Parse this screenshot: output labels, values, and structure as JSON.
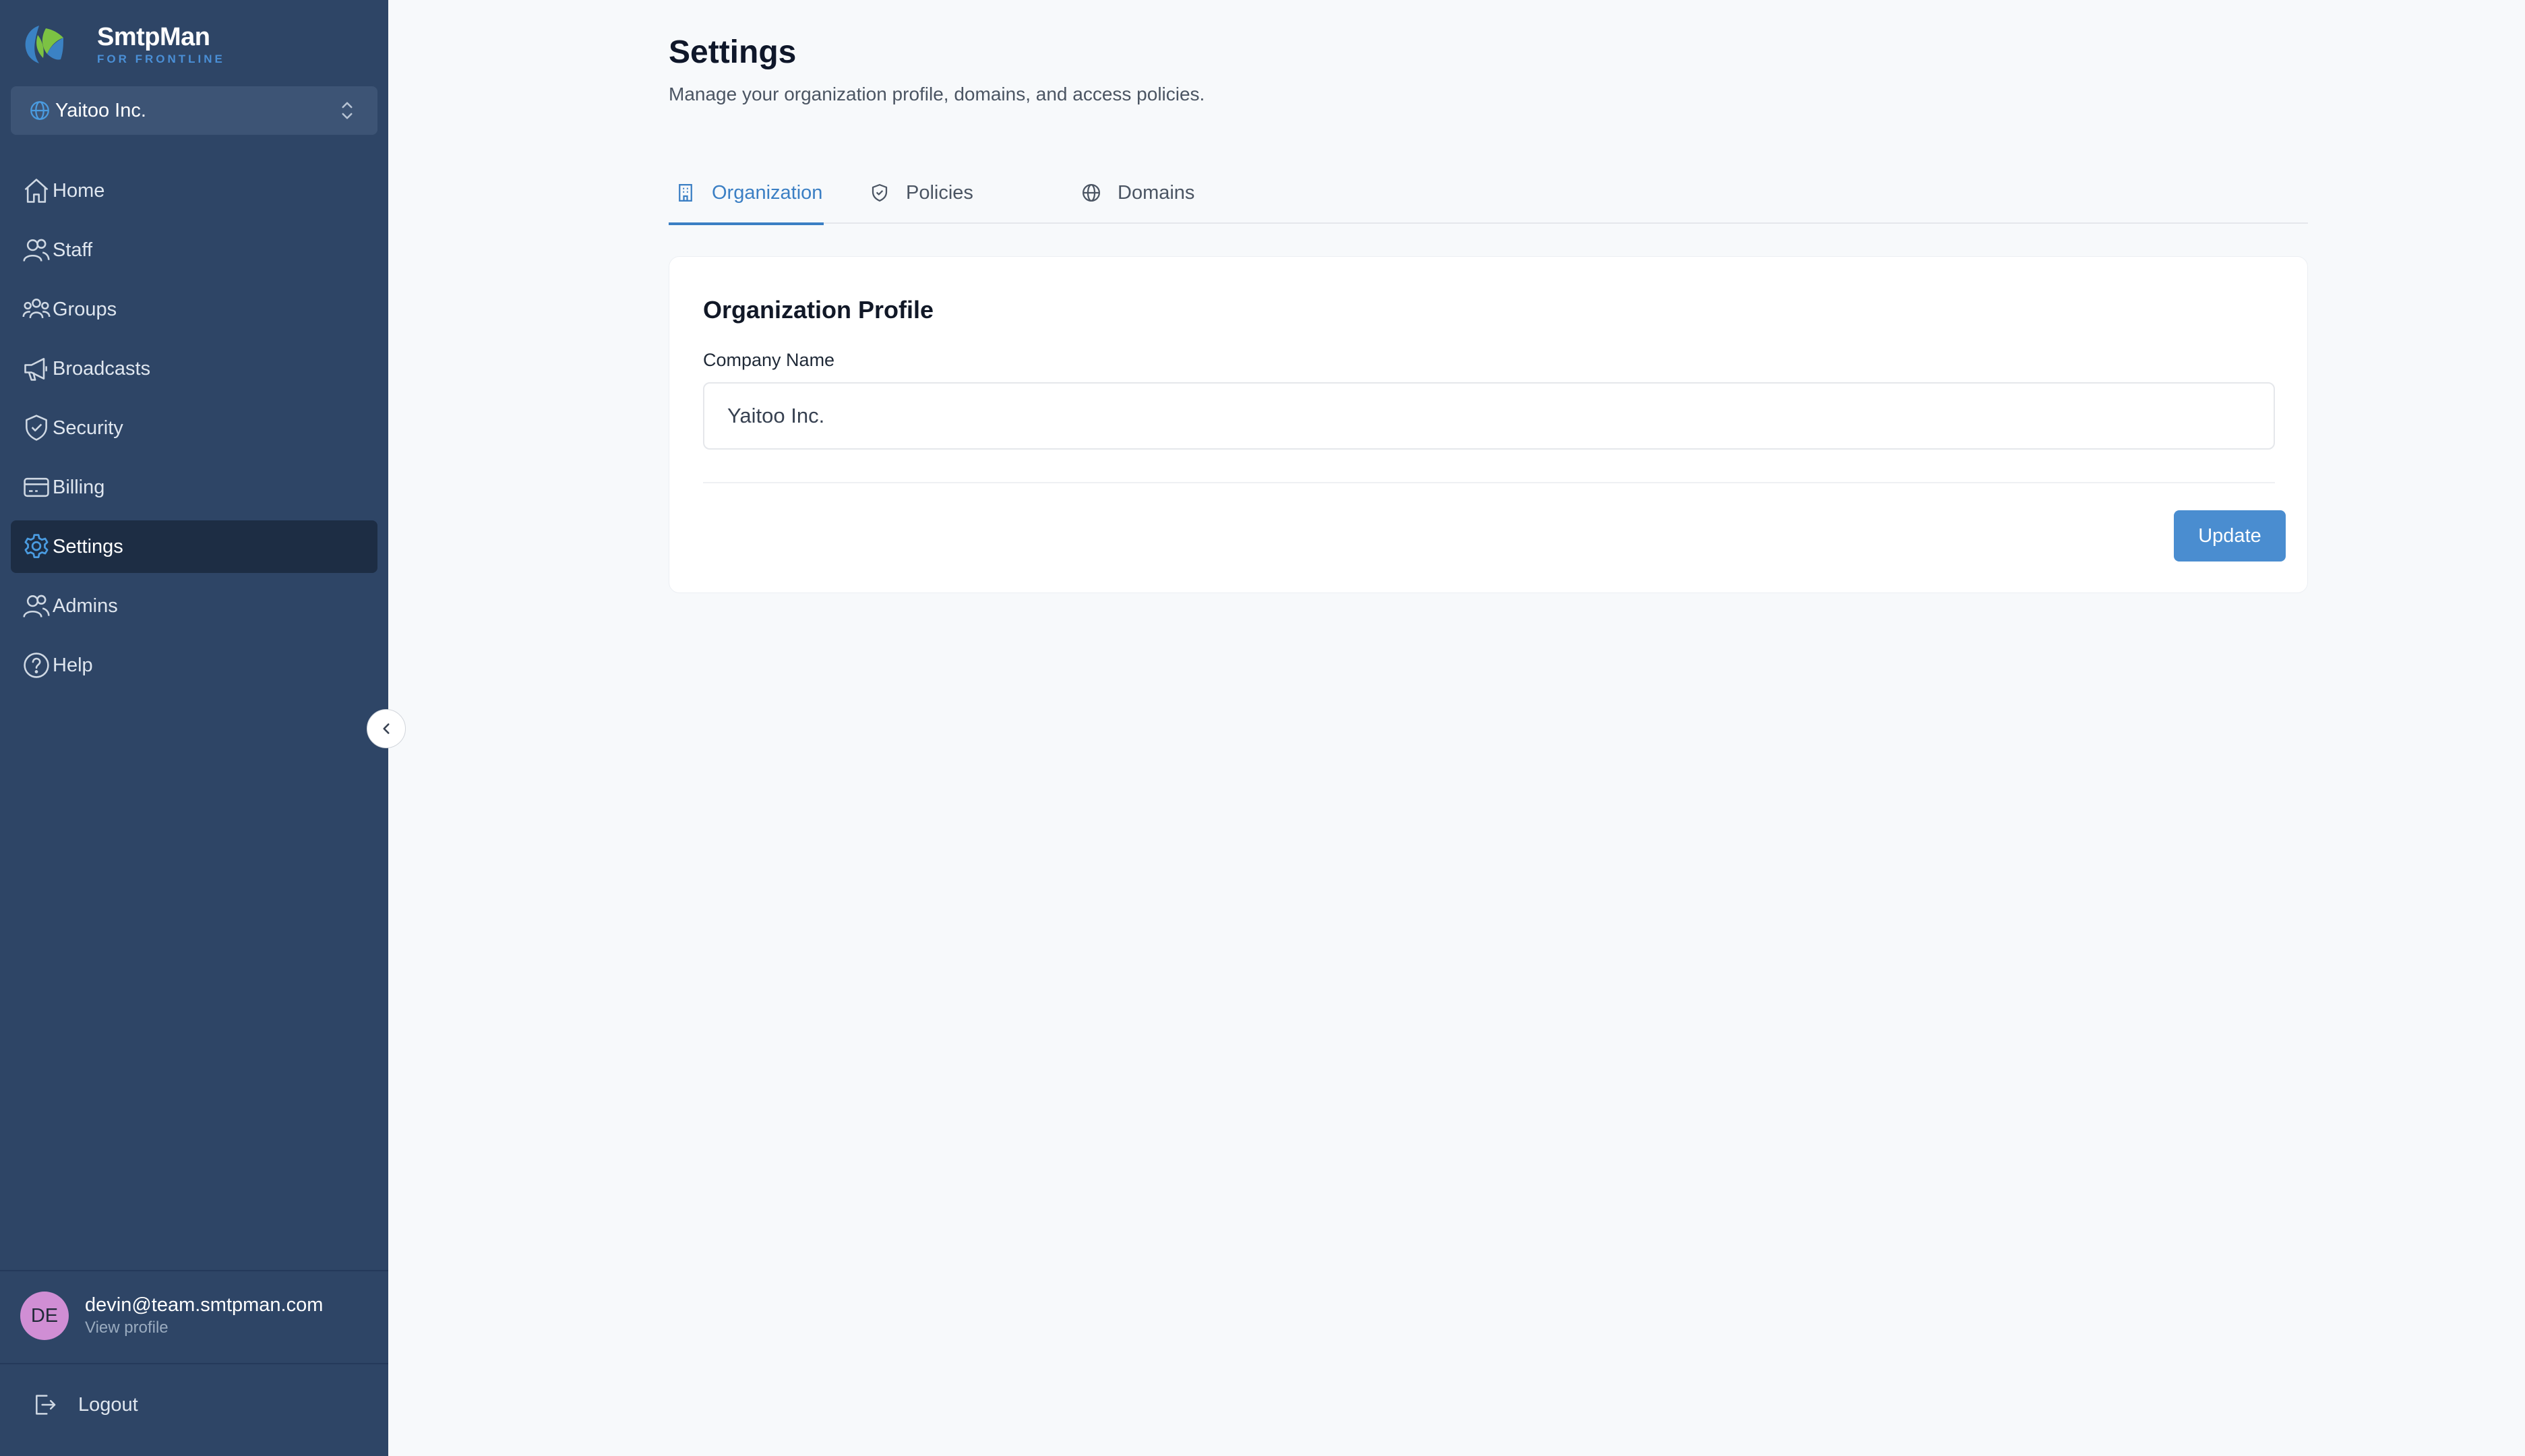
{
  "brand": {
    "name": "SmtpMan",
    "tagline": "FOR FRONTLINE"
  },
  "org_selector": {
    "value": "Yaitoo Inc."
  },
  "sidebar": {
    "items": [
      {
        "label": "Home",
        "icon": "home-icon"
      },
      {
        "label": "Staff",
        "icon": "users-icon"
      },
      {
        "label": "Groups",
        "icon": "user-group-icon"
      },
      {
        "label": "Broadcasts",
        "icon": "megaphone-icon"
      },
      {
        "label": "Security",
        "icon": "shield-check-icon"
      },
      {
        "label": "Billing",
        "icon": "credit-card-icon"
      },
      {
        "label": "Settings",
        "icon": "gear-icon",
        "active": true
      },
      {
        "label": "Admins",
        "icon": "users-icon"
      },
      {
        "label": "Help",
        "icon": "help-circle-icon"
      }
    ]
  },
  "user": {
    "initials": "DE",
    "email": "devin@team.smtpman.com",
    "view_profile": "View profile"
  },
  "logout": {
    "label": "Logout"
  },
  "page": {
    "title": "Settings",
    "subtitle": "Manage your organization profile, domains, and access policies."
  },
  "tabs": [
    {
      "label": "Organization",
      "icon": "building-icon",
      "active": true
    },
    {
      "label": "Policies",
      "icon": "shield-icon"
    },
    {
      "label": "Domains",
      "icon": "globe-icon"
    }
  ],
  "org_profile": {
    "title": "Organization Profile",
    "company_name_label": "Company Name",
    "company_name_value": "Yaitoo Inc.",
    "update_label": "Update"
  },
  "colors": {
    "sidebar_bg": "#2e4566",
    "sidebar_active": "#1d2d44",
    "accent": "#3b7fc4",
    "button": "#4a8dd0",
    "avatar": "#d08ed4"
  }
}
